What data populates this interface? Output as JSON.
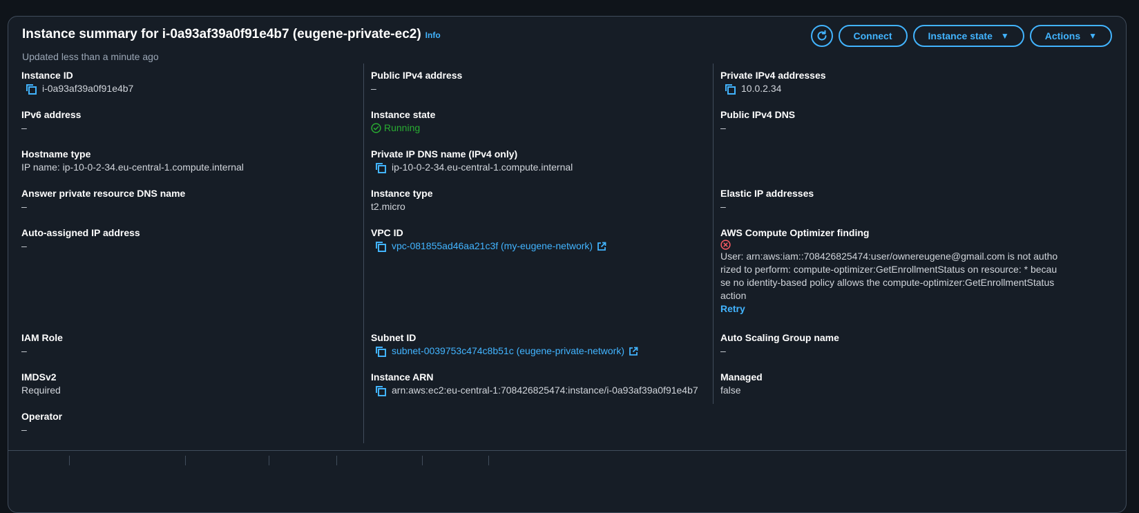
{
  "header": {
    "title": "Instance summary for i-0a93af39a0f91e4b7 (eugene-private-ec2)",
    "info_label": "Info",
    "updated_text": "Updated less than a minute ago",
    "connect_label": "Connect",
    "instance_state_label": "Instance state",
    "actions_label": "Actions",
    "refresh_icon": "refresh-icon"
  },
  "colors": {
    "background": "#0f141a",
    "panel": "#161d26",
    "accent": "#42b4ff",
    "success": "#29ad32",
    "error": "#ff5d64"
  },
  "col1": {
    "instance_id": {
      "label": "Instance ID",
      "value": "i-0a93af39a0f91e4b7"
    },
    "ipv6": {
      "label": "IPv6 address",
      "value": "–"
    },
    "hostname_type": {
      "label": "Hostname type",
      "value": "IP name: ip-10-0-2-34.eu-central-1.compute.internal"
    },
    "answer_dns": {
      "label": "Answer private resource DNS name",
      "value": "–"
    },
    "auto_ip": {
      "label": "Auto-assigned IP address",
      "value": "–"
    },
    "iam_role": {
      "label": "IAM Role",
      "value": "–"
    },
    "imdsv2": {
      "label": "IMDSv2",
      "value": "Required"
    },
    "operator": {
      "label": "Operator",
      "value": "–"
    }
  },
  "col2": {
    "public_ipv4": {
      "label": "Public IPv4 address",
      "value": "–"
    },
    "instance_state": {
      "label": "Instance state",
      "value": "Running"
    },
    "private_dns": {
      "label": "Private IP DNS name (IPv4 only)",
      "value": "ip-10-0-2-34.eu-central-1.compute.internal"
    },
    "instance_type": {
      "label": "Instance type",
      "value": "t2.micro"
    },
    "vpc_id": {
      "label": "VPC ID",
      "value": "vpc-081855ad46aa21c3f (my-eugene-network)"
    },
    "subnet_id": {
      "label": "Subnet ID",
      "value": "subnet-0039753c474c8b51c (eugene-private-network)"
    },
    "instance_arn": {
      "label": "Instance ARN",
      "value": "arn:aws:ec2:eu-central-1:708426825474:instance/i-0a93af39a0f91e4b7"
    }
  },
  "col3": {
    "private_ipv4": {
      "label": "Private IPv4 addresses",
      "value": "10.0.2.34"
    },
    "public_dns": {
      "label": "Public IPv4 DNS",
      "value": "–"
    },
    "elastic_ip": {
      "label": "Elastic IP addresses",
      "value": "–"
    },
    "optimizer": {
      "label": "AWS Compute Optimizer finding",
      "error": "User: arn:aws:iam::708426825474:user/ownereugene@gmail.com is not authorized to perform: compute-optimizer:GetEnrollmentStatus on resource: * because no identity-based policy allows the compute-optimizer:GetEnrollmentStatus action",
      "retry_label": "Retry"
    },
    "asg": {
      "label": "Auto Scaling Group name",
      "value": "–"
    },
    "managed": {
      "label": "Managed",
      "value": "false"
    }
  }
}
